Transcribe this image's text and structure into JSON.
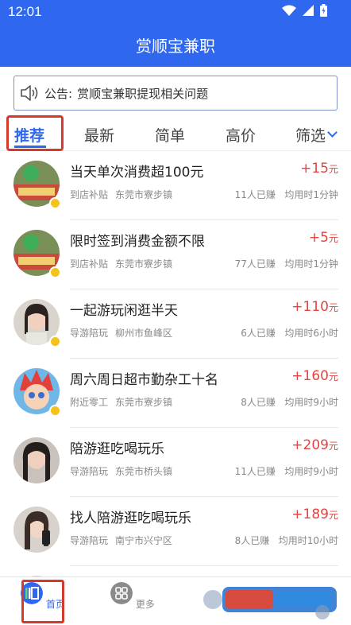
{
  "status": {
    "time": "12:01"
  },
  "header": {
    "title": "赏顺宝兼职"
  },
  "notice": {
    "label": "公告:",
    "text": "赏顺宝兼职提现相关问题",
    "icon": "speaker-icon"
  },
  "tabs": [
    {
      "label": "推荐",
      "active": true
    },
    {
      "label": "最新"
    },
    {
      "label": "简单"
    },
    {
      "label": "高价"
    },
    {
      "label": "筛选"
    }
  ],
  "jobs": [
    {
      "title": "当天单次消费超100元",
      "price": "+15",
      "unit": "元",
      "tag": "到店补贴",
      "location": "东莞市寮步镇",
      "earned": "11人已赚",
      "duration": "均用时1分钟"
    },
    {
      "title": "限时签到消费金额不限",
      "price": "+5",
      "unit": "元",
      "tag": "到店补贴",
      "location": "东莞市寮步镇",
      "earned": "77人已赚",
      "duration": "均用时1分钟"
    },
    {
      "title": "一起游玩闲逛半天",
      "price": "+110",
      "unit": "元",
      "tag": "导游陪玩",
      "location": "柳州市鱼峰区",
      "earned": "6人已赚",
      "duration": "均用时6小时"
    },
    {
      "title": "周六周日超市勤杂工十名",
      "price": "+160",
      "unit": "元",
      "tag": "附近零工",
      "location": "东莞市寮步镇",
      "earned": "8人已赚",
      "duration": "均用时9小时"
    },
    {
      "title": "陪游逛吃喝玩乐",
      "price": "+209",
      "unit": "元",
      "tag": "导游陪玩",
      "location": "东莞市桥头镇",
      "earned": "11人已赚",
      "duration": "均用时9小时"
    },
    {
      "title": "找人陪游逛吃喝玩乐",
      "price": "+189",
      "unit": "元",
      "tag": "导游陪玩",
      "location": "南宁市兴宁区",
      "earned": "8人已赚",
      "duration": "均用时10小时"
    }
  ],
  "bottom_nav": [
    {
      "label": "首页",
      "active": true
    },
    {
      "label": "更多"
    }
  ],
  "colors": {
    "brand": "#2f67ee",
    "price": "#e64340",
    "highlight": "#d43a2a"
  }
}
